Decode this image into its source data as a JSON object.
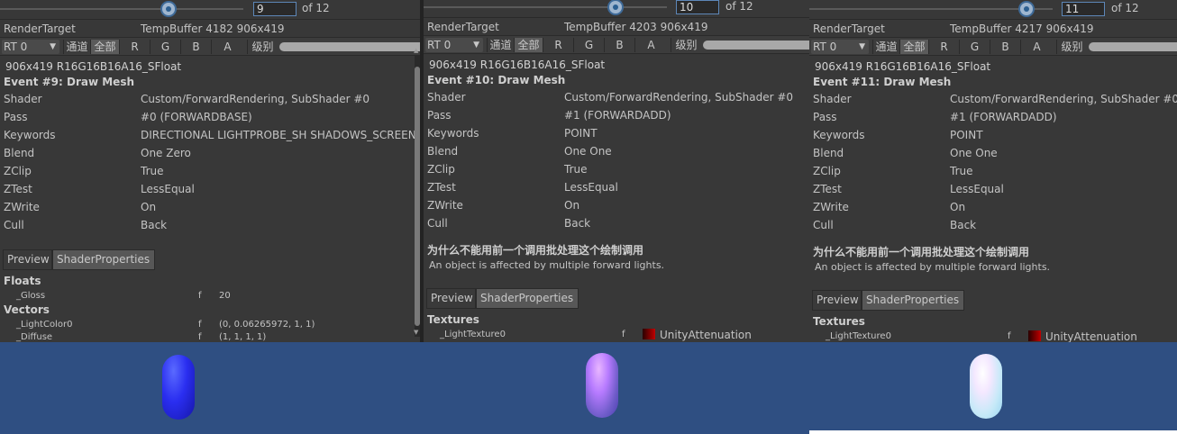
{
  "common": {
    "of_label": "of 12",
    "render_target_label": "RenderTarget",
    "rt_select": "RT 0",
    "channels_label": "通道",
    "all_label": "全部",
    "r": "R",
    "g": "G",
    "b": "B",
    "a": "A",
    "level_label": "级别",
    "format": "906x419 R16G16B16A16_SFloat",
    "labels": {
      "shader": "Shader",
      "pass": "Pass",
      "keywords": "Keywords",
      "blend": "Blend",
      "zclip": "ZClip",
      "ztest": "ZTest",
      "zwrite": "ZWrite",
      "cull": "Cull"
    },
    "tab_preview": "Preview",
    "tab_shader_properties": "ShaderProperties",
    "why_not_batched": "为什么不能用前一个调用批处理这个绘制调用",
    "batch_reason": "An object is affected by multiple forward lights."
  },
  "panel1": {
    "event_index": "9",
    "render_target_value": "TempBuffer 4182 906x419",
    "event_title": "Event #9: Draw Mesh",
    "shader": "Custom/ForwardRendering, SubShader #0",
    "pass": "#0 (FORWARDBASE)",
    "keywords": "DIRECTIONAL LIGHTPROBE_SH SHADOWS_SCREEN",
    "blend": "One Zero",
    "zclip": "True",
    "ztest": "LessEqual",
    "zwrite": "On",
    "cull": "Back",
    "floats_head": "Floats",
    "gloss_name": "_Gloss",
    "gloss_f": "f",
    "gloss_value": "20",
    "vectors_head": "Vectors",
    "lightcolor_name": "_LightColor0",
    "lightcolor_f": "f",
    "lightcolor_value": "(0, 0.06265972, 1, 1)",
    "diffuse_name": "_Diffuse",
    "diffuse_f": "f",
    "diffuse_value": "(1, 1, 1, 1)"
  },
  "panel2": {
    "event_index": "10",
    "render_target_value": "TempBuffer 4203 906x419",
    "event_title": "Event #10: Draw Mesh",
    "shader": "Custom/ForwardRendering, SubShader #0",
    "pass": "#1 (FORWARDADD)",
    "keywords": "POINT",
    "blend": "One One",
    "zclip": "True",
    "ztest": "LessEqual",
    "zwrite": "On",
    "cull": "Back",
    "textures_head": "Textures",
    "tex_name": "_LightTexture0",
    "tex_f": "f",
    "tex_value": "UnityAttenuation"
  },
  "panel3": {
    "event_index": "11",
    "render_target_value": "TempBuffer 4217 906x419",
    "event_title": "Event #11: Draw Mesh",
    "shader": "Custom/ForwardRendering, SubShader #0",
    "pass": "#1 (FORWARDADD)",
    "keywords": "POINT",
    "blend": "One One",
    "zclip": "True",
    "ztest": "LessEqual",
    "zwrite": "On",
    "cull": "Back",
    "textures_head": "Textures",
    "tex_name": "_LightTexture0",
    "tex_f": "f",
    "tex_value": "UnityAttenuation"
  }
}
